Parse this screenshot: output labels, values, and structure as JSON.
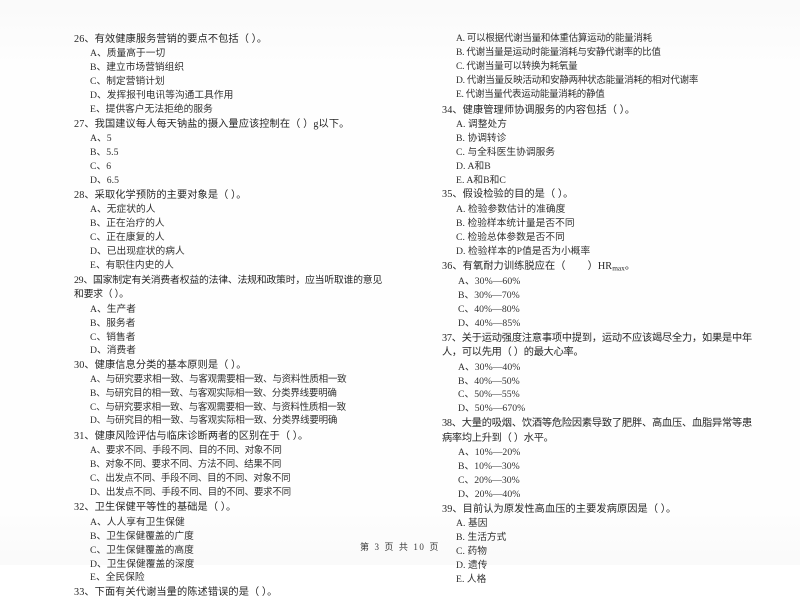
{
  "document": {
    "type": "scanned-exam-paper",
    "footer": "第 3 页  共 10 页",
    "page_number": "3",
    "total_pages": "10"
  },
  "left_column": {
    "questions": [
      {
        "number": "26",
        "stem": "26、有效健康服务营销的要点不包括（    ）。",
        "options": [
          "A、质量高于一切",
          "B、建立市场营销组织",
          "C、制定营销计划",
          "D、发挥报刊电讯等沟通工具作用",
          "E、提供客户无法拒绝的服务"
        ]
      },
      {
        "number": "27",
        "stem": "27、我国建议每人每天钠盐的摄入量应该控制在（    ）g以下。",
        "options": [
          "A、5",
          "B、5.5",
          "C、6",
          "D、6.5"
        ]
      },
      {
        "number": "28",
        "stem": "28、采取化学预防的主要对象是（    ）。",
        "options": [
          "A、无症状的人",
          "B、正在治疗的人",
          "C、正在康复的人",
          "D、已出现症状的病人",
          "E、有职住内史的人"
        ]
      },
      {
        "number": "29",
        "stem": "29、国家制定有关消费者权益的法律、法规和政策时，应当听取谁的意见和要求（    ）。",
        "options": [
          "A、生产者",
          "B、服务者",
          "C、销售者",
          "D、消费者"
        ]
      },
      {
        "number": "30",
        "stem": "30、健康信息分类的基本原则是（    ）。",
        "options": [
          "A、与研究要求相一致、与客观需要相一致、与资料性质相一致",
          "B、与研究目的相一致、与客观实际相一致、分类界线要明确",
          "C、与研究要求相一致、与客观需要相一致、与资料性质相一致",
          "D、与研究目的相一致、与客观实际相一致、分类界线要明确"
        ]
      },
      {
        "number": "31",
        "stem": "31、健康风险评估与临床诊断两者的区别在于（    ）。",
        "options": [
          "A、要求不同、手段不同、目的不同、对象不同",
          "B、对象不同、要求不同、方法不同、结果不同",
          "C、出发点不同、手段不同、目的不同、对象不同",
          "D、出发点不同、手段不同、目的不同、要求不同"
        ]
      },
      {
        "number": "32",
        "stem": "32、卫生保健平等性的基础是（    ）。",
        "options": [
          "A、人人享有卫生保健",
          "B、卫生保健覆盖的广度",
          "C、卫生保健覆盖的高度",
          "D、卫生保健覆盖的深度",
          "E、全民保险"
        ]
      },
      {
        "number": "33",
        "stem": "33、下面有关代谢当量的陈述错误的是（    ）。",
        "options": []
      }
    ]
  },
  "right_column": {
    "questions": [
      {
        "number": "33-continued",
        "stem": "",
        "options": [
          "A. 可以根据代谢当量和体重估算运动的能量消耗",
          "B. 代谢当量是运动时能量消耗与安静代谢率的比值",
          "C. 代谢当量可以转换为耗氧量",
          "D. 代谢当量反映活动和安静两种状态能量消耗的相对代谢率",
          "E. 代谢当量代表运动能量消耗的静值"
        ]
      },
      {
        "number": "34",
        "stem": "34、健康管理师协调服务的内容包括（    ）。",
        "options": [
          "A. 调整处方",
          "B. 协调转诊",
          "C. 与全科医生协调服务",
          "D. A和B",
          "E. A和B和C"
        ]
      },
      {
        "number": "35",
        "stem": "35、假设检验的目的是（    ）。",
        "options": [
          "A. 检验参数估计的准确度",
          "B. 检验样本统计量是否不同",
          "C. 检验总体参数是否不同",
          "D. 检验样本的P值是否为小概率"
        ]
      },
      {
        "number": "36",
        "stem": "36、有氧耐力训练脱应在（    ）HRmax。",
        "stem_prefix": "36、有氧耐力训练脱应在（",
        "stem_suffix": "）HR",
        "stem_sub": "max",
        "stem_end": "。",
        "options": [
          "A、30%—60%",
          "B、30%—70%",
          "C、40%—80%",
          "D、40%—85%"
        ]
      },
      {
        "number": "37",
        "stem": "37、关于运动强度注意事项中提到，运动不应该竭尽全力，如果是中年人，可以先用（    ）的最大心率。",
        "options": [
          "A、30%—40%",
          "B、40%—50%",
          "C、50%—55%",
          "D、50%—670%"
        ]
      },
      {
        "number": "38",
        "stem": "38、大量的吸烟、饮酒等危险因素导致了肥胖、高血压、血脂异常等患病率均上升到（    ）水平。",
        "options": [
          "A、10%—20%",
          "B、10%—30%",
          "C、20%—30%",
          "D、20%—40%"
        ]
      },
      {
        "number": "39",
        "stem": "39、目前认为原发性高血压的主要发病原因是（    ）。",
        "options": [
          "A. 基因",
          "B. 生活方式",
          "C. 药物",
          "D. 遗传",
          "E. 人格"
        ]
      }
    ]
  }
}
